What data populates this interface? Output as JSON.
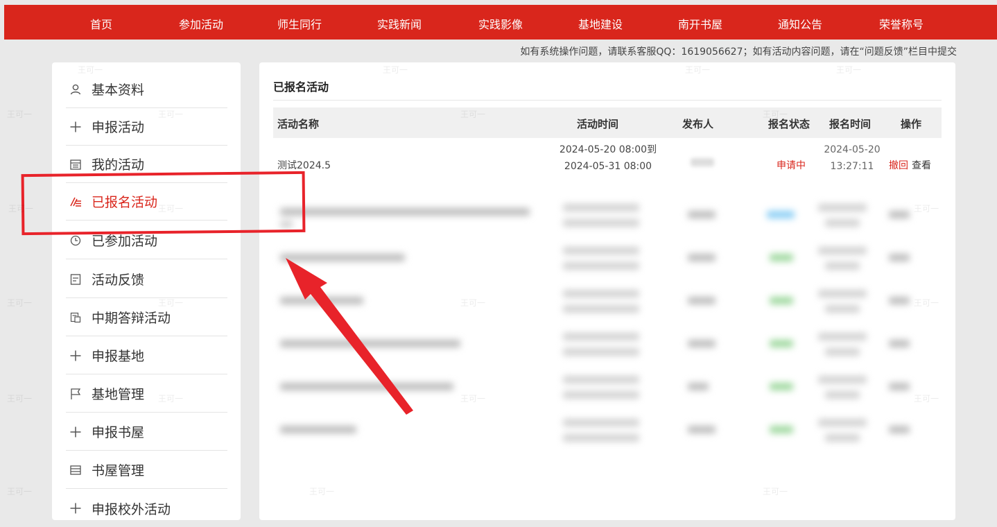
{
  "nav": {
    "items": [
      "首页",
      "参加活动",
      "师生同行",
      "实践新闻",
      "实践影像",
      "基地建设",
      "南开书屋",
      "通知公告",
      "荣誉称号"
    ]
  },
  "notice": "如有系统操作问题，请联系客服QQ：1619056627；如有活动内容问题，请在“问题反馈”栏目中提交",
  "sidebar": {
    "items": [
      {
        "label": "基本资料",
        "icon": "user-icon"
      },
      {
        "label": "申报活动",
        "icon": "plus-icon"
      },
      {
        "label": "我的活动",
        "icon": "calendar-icon"
      },
      {
        "label": "已报名活动",
        "icon": "edit-list-icon"
      },
      {
        "label": "已参加活动",
        "icon": "clock-icon"
      },
      {
        "label": "活动反馈",
        "icon": "feedback-icon"
      },
      {
        "label": "中期答辩活动",
        "icon": "document-icon"
      },
      {
        "label": "申报基地",
        "icon": "plus-icon"
      },
      {
        "label": "基地管理",
        "icon": "flag-icon"
      },
      {
        "label": "申报书屋",
        "icon": "plus-icon"
      },
      {
        "label": "书屋管理",
        "icon": "list-icon"
      },
      {
        "label": "申报校外活动",
        "icon": "plus-icon"
      }
    ],
    "active_index": 3
  },
  "panel": {
    "title": "已报名活动",
    "columns": [
      "活动名称",
      "活动时间",
      "发布人",
      "报名状态",
      "报名时间",
      "操作"
    ],
    "row": {
      "name": "测试2024.5",
      "time_start": "2024-05-20 08:00到",
      "time_end": "2024-05-31 08:00",
      "status": "申请中",
      "signup_date": "2024-05-20",
      "signup_time": "13:27:11",
      "action_withdraw": "撤回",
      "action_view": "查看"
    }
  },
  "watermark": "王可一",
  "colors": {
    "brand": "#d9261c",
    "annotation": "#e8232a"
  }
}
